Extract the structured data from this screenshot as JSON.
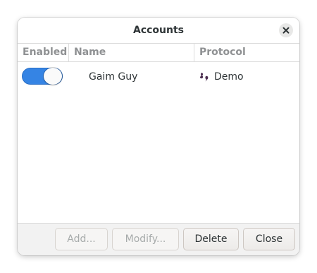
{
  "window": {
    "title": "Accounts"
  },
  "columns": {
    "enabled": "Enabled",
    "name": "Name",
    "protocol": "Protocol"
  },
  "accounts": [
    {
      "enabled": true,
      "name": "Gaim Guy",
      "protocol": "Demo",
      "protocol_icon": "demo-protocol-icon"
    }
  ],
  "buttons": {
    "add": "Add...",
    "modify": "Modify...",
    "delete": "Delete",
    "close": "Close"
  },
  "colors": {
    "switch_on": "#3584e4",
    "protocol_icon": "#4a2d4f"
  }
}
